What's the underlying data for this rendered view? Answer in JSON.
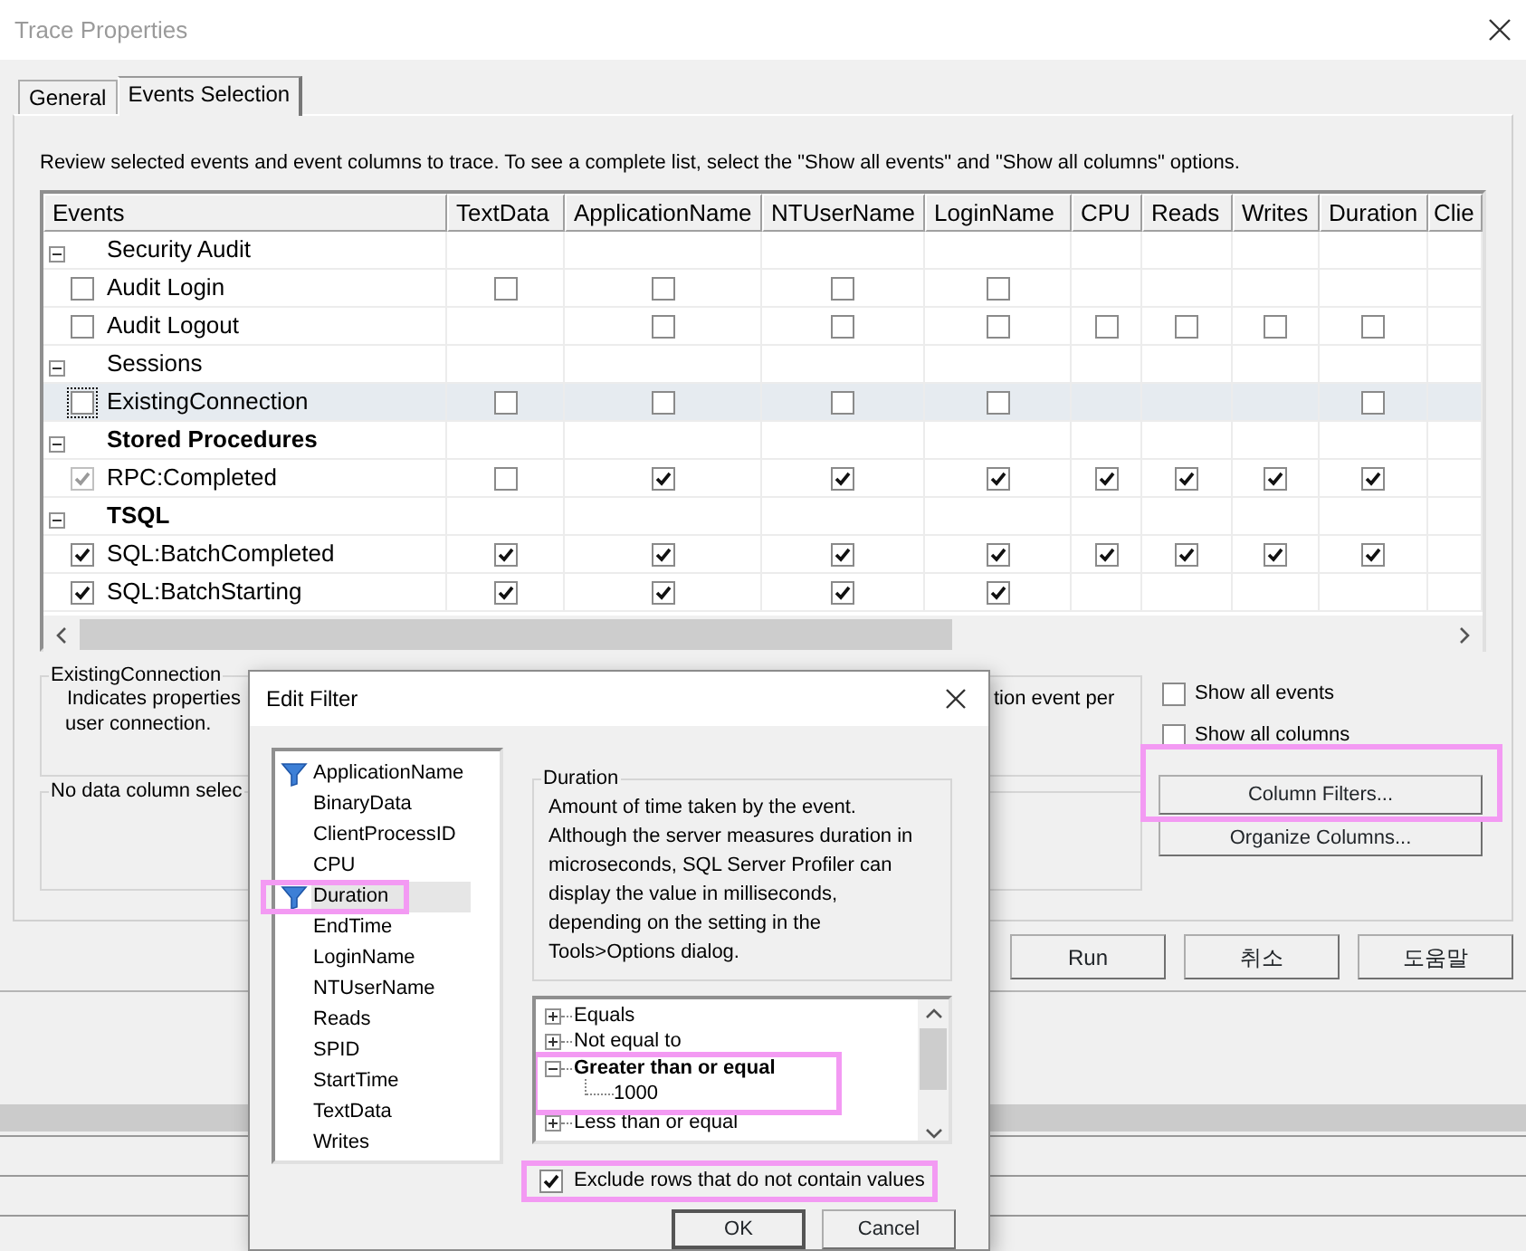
{
  "window": {
    "title": "Trace Properties"
  },
  "tabs": [
    {
      "label": "General",
      "selected": false
    },
    {
      "label": "Events Selection",
      "selected": true
    }
  ],
  "instructions": "Review selected events and event columns to trace. To see a complete list, select the \"Show all events\" and \"Show all columns\" options.",
  "events_table": {
    "columns": [
      "Events",
      "TextData",
      "ApplicationName",
      "NTUserName",
      "LoginName",
      "CPU",
      "Reads",
      "Writes",
      "Duration",
      "Clie"
    ],
    "rows": [
      {
        "kind": "category",
        "label": "Security Audit",
        "expanded": true,
        "has_selected": false
      },
      {
        "kind": "event",
        "label": "Audit Login",
        "checked": false,
        "disabled": false,
        "selected": false,
        "cells": [
          false,
          false,
          false,
          false,
          null,
          null,
          null,
          null,
          null
        ]
      },
      {
        "kind": "event",
        "label": "Audit Logout",
        "checked": false,
        "disabled": false,
        "selected": false,
        "cells": [
          null,
          false,
          false,
          false,
          false,
          false,
          false,
          false,
          null
        ]
      },
      {
        "kind": "category",
        "label": "Sessions",
        "expanded": true,
        "has_selected": false
      },
      {
        "kind": "event",
        "label": "ExistingConnection",
        "checked": false,
        "disabled": false,
        "selected": true,
        "cells": [
          false,
          false,
          false,
          false,
          null,
          null,
          null,
          false,
          null
        ]
      },
      {
        "kind": "category",
        "label": "Stored Procedures",
        "expanded": true,
        "has_selected": true
      },
      {
        "kind": "event",
        "label": "RPC:Completed",
        "checked": true,
        "disabled": true,
        "selected": false,
        "cells": [
          false,
          true,
          true,
          true,
          true,
          true,
          true,
          true,
          null
        ]
      },
      {
        "kind": "category",
        "label": "TSQL",
        "expanded": true,
        "has_selected": true
      },
      {
        "kind": "event",
        "label": "SQL:BatchCompleted",
        "checked": true,
        "disabled": false,
        "selected": false,
        "cells": [
          true,
          true,
          true,
          true,
          true,
          true,
          true,
          true,
          null
        ]
      },
      {
        "kind": "event",
        "label": "SQL:BatchStarting",
        "checked": true,
        "disabled": false,
        "selected": false,
        "cells": [
          true,
          true,
          true,
          true,
          null,
          null,
          null,
          null,
          null
        ]
      }
    ]
  },
  "event_info": {
    "title": "ExistingConnection",
    "line_1": "Indicates properties",
    "line_2": "user connection.",
    "right_text": "tion event per"
  },
  "column_info": {
    "title": "No data column selec"
  },
  "options": [
    {
      "label": "Show all events",
      "checked": false
    },
    {
      "label": "Show all columns",
      "checked": false
    }
  ],
  "side_buttons": [
    {
      "label": "Column Filters...",
      "highlighted": true
    },
    {
      "label": "Organize Columns...",
      "highlighted": false
    }
  ],
  "footer_buttons": [
    "Run",
    "취소",
    "도움말"
  ],
  "edit_filter": {
    "title": "Edit Filter",
    "columns": [
      {
        "label": "ApplicationName",
        "filtered": true,
        "selected": false,
        "highlighted": false
      },
      {
        "label": "BinaryData",
        "filtered": false,
        "selected": false,
        "highlighted": false
      },
      {
        "label": "ClientProcessID",
        "filtered": false,
        "selected": false,
        "highlighted": false
      },
      {
        "label": "CPU",
        "filtered": false,
        "selected": false,
        "highlighted": false
      },
      {
        "label": "Duration",
        "filtered": true,
        "selected": true,
        "highlighted": true
      },
      {
        "label": "EndTime",
        "filtered": false,
        "selected": false,
        "highlighted": false
      },
      {
        "label": "LoginName",
        "filtered": false,
        "selected": false,
        "highlighted": false
      },
      {
        "label": "NTUserName",
        "filtered": false,
        "selected": false,
        "highlighted": false
      },
      {
        "label": "Reads",
        "filtered": false,
        "selected": false,
        "highlighted": false
      },
      {
        "label": "SPID",
        "filtered": false,
        "selected": false,
        "highlighted": false
      },
      {
        "label": "StartTime",
        "filtered": false,
        "selected": false,
        "highlighted": false
      },
      {
        "label": "TextData",
        "filtered": false,
        "selected": false,
        "highlighted": false
      },
      {
        "label": "Writes",
        "filtered": false,
        "selected": false,
        "highlighted": false
      }
    ],
    "detail": {
      "title": "Duration",
      "description": "Amount of time taken by the event. Although the server measures duration in microseconds, SQL Server Profiler can display the value in milliseconds, depending on the setting in the Tools>Options dialog."
    },
    "operators": [
      {
        "label": "Equals",
        "expanded": false,
        "highlighted": false
      },
      {
        "label": "Not equal to",
        "expanded": false,
        "highlighted": false
      },
      {
        "label": "Greater than or equal",
        "expanded": true,
        "highlighted": true,
        "children": [
          "1000"
        ]
      },
      {
        "label": "Less than or equal",
        "expanded": false,
        "highlighted": false
      }
    ],
    "exclude": {
      "label": "Exclude rows that do not contain values",
      "checked": true,
      "highlighted": true
    },
    "buttons": [
      "OK",
      "Cancel"
    ]
  }
}
